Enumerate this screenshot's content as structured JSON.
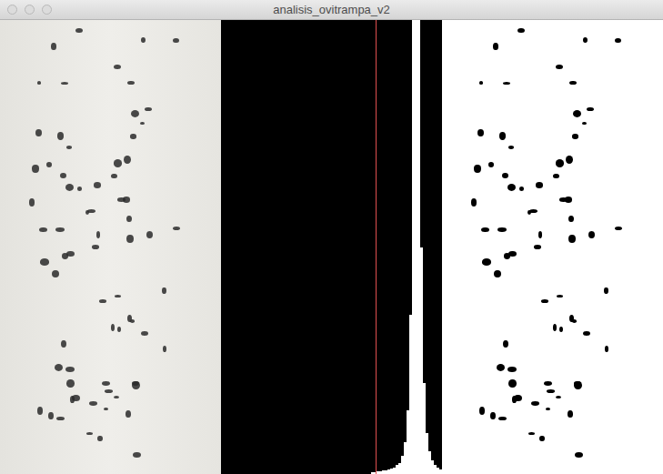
{
  "window": {
    "title": "analisis_ovitrampa_v2"
  },
  "histogram": {
    "axis_max": 100,
    "threshold": {
      "level": 0.7
    },
    "values": [
      0,
      0,
      0,
      0,
      0,
      0,
      0,
      0,
      0,
      0,
      0,
      0,
      0,
      0,
      0,
      0,
      0,
      0,
      0,
      0,
      0,
      0,
      0,
      0,
      0,
      0,
      0,
      0,
      0,
      0,
      0,
      0,
      0,
      0,
      0,
      0,
      0,
      0,
      0,
      0,
      0,
      0,
      0,
      0,
      0,
      0,
      0,
      0,
      0,
      0,
      0,
      0,
      0,
      0,
      0,
      0.5,
      0.5,
      0.6,
      0.7,
      0.8,
      0.9,
      1,
      1.2,
      1.5,
      2,
      2.5,
      4,
      7,
      14,
      35,
      130,
      140,
      110,
      50,
      20,
      9,
      5,
      3,
      2,
      1.5,
      1
    ]
  }
}
